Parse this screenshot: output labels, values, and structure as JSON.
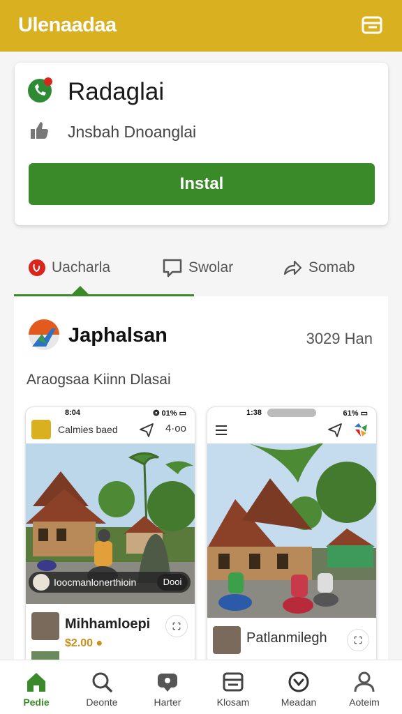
{
  "topbar": {
    "title": "Ulenaadaa",
    "menu_icon": "store-icon"
  },
  "app_card": {
    "name": "Radaglai",
    "subtitle": "Jnsbah Dnoanglai",
    "install_label": "Instal"
  },
  "tabs": [
    {
      "label": "Uacharla",
      "icon": "brand-icon",
      "active": true
    },
    {
      "label": "Swolar",
      "icon": "chat-icon",
      "active": false
    },
    {
      "label": "Somab",
      "icon": "share-icon",
      "active": false
    }
  ],
  "post": {
    "name": "Japhalsan",
    "count": "3029 Han",
    "description": "Araogsaa Kiinn Dlasai"
  },
  "screenshots": [
    {
      "time": "8:04",
      "status": "❂ 01% ▭",
      "header_title": "Calmies baed",
      "header_more": "4·oo",
      "caption": "Ioocmanlonerthioin",
      "caption_button": "Dooi",
      "user_name": "Mihhamloepi",
      "price": "$2.00 ●"
    },
    {
      "time": "1:38",
      "status": "61% ▭",
      "user_name": "Patlanmilegh"
    }
  ],
  "nav": [
    {
      "label": "Pedie",
      "icon": "home-icon",
      "active": true
    },
    {
      "label": "Deonte",
      "icon": "search-icon",
      "active": false
    },
    {
      "label": "Harter",
      "icon": "message-icon",
      "active": false
    },
    {
      "label": "Klosam",
      "icon": "list-icon",
      "active": false
    },
    {
      "label": "Meadan",
      "icon": "check-circle-icon",
      "active": false
    },
    {
      "label": "Aoteim",
      "icon": "person-icon",
      "active": false
    }
  ],
  "colors": {
    "accent": "#3a8a2a",
    "topbar": "#d9b020",
    "price": "#c8901a"
  }
}
